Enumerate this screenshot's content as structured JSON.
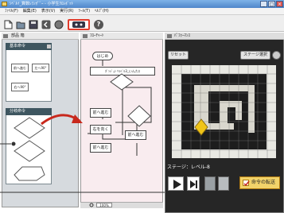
{
  "window": {
    "title": "ｼﾍﾞﾙｲ_算数ﾚﾗﾝｵﾞﾞｰ - 小学生ｸﾛﾚﾎﾞｯﾄ",
    "minimize": "_",
    "maximize": "□",
    "close": "×"
  },
  "menu": [
    "ﾌｧｲﾙ(F)",
    "編集(E)",
    "表示(V)",
    "実行(R)",
    "ﾂｰﾙ(T)",
    "ﾍﾙﾌﾟ(H)"
  ],
  "toolbar_icons": [
    "new-file-icon",
    "open-folder-icon",
    "save-icon",
    "back-icon",
    "record-icon",
    "robot-icon",
    "help-icon"
  ],
  "toolbar_help": "?",
  "left_panel": {
    "title": "部品 箱",
    "group1": {
      "title": "基本命令",
      "blocks": [
        "前へ進む",
        "左へ90°",
        "右へ90°"
      ]
    },
    "group2": {
      "title": "分岐命令"
    }
  },
  "editor": {
    "title": "ﾌﾛｰﾁｬｰﾄ",
    "start": "はじめ",
    "banner": "ﾀﾞﾝｼﾞｮﾝ ﾘﾗﾍﾞﾙ3_いんたﾛ",
    "blocks": [
      "前へ進む",
      "右を向く",
      "前へ進む",
      "前へ進む"
    ],
    "zoom": "100%"
  },
  "stage": {
    "title": "ﾊﾟﾌｫｰﾏﾝｽ",
    "reset": "リセット",
    "select": "ステージ選択",
    "label": "ステージ：レベル-8",
    "send": "命令の転送"
  }
}
